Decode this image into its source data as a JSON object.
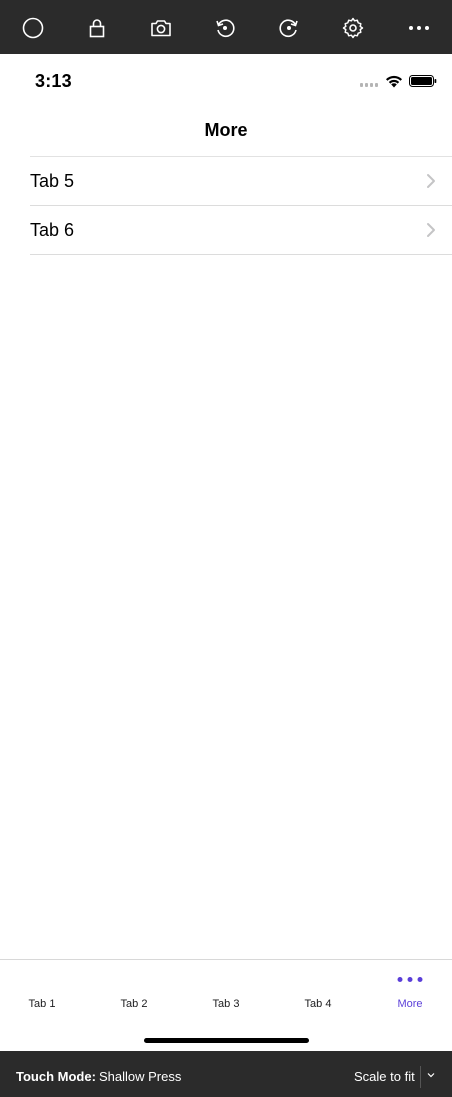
{
  "toolbar": {
    "buttons": [
      {
        "icon": "home-circle-icon"
      },
      {
        "icon": "lock-icon"
      },
      {
        "icon": "camera-icon"
      },
      {
        "icon": "rotate-left-icon"
      },
      {
        "icon": "rotate-right-icon"
      },
      {
        "icon": "gear-icon"
      },
      {
        "icon": "more-horizontal-icon"
      }
    ]
  },
  "status_bar": {
    "time": "3:13"
  },
  "nav": {
    "title": "More"
  },
  "more_list": [
    {
      "label": "Tab 5"
    },
    {
      "label": "Tab 6"
    }
  ],
  "tab_bar": {
    "tabs": [
      {
        "label": "Tab 1"
      },
      {
        "label": "Tab 2"
      },
      {
        "label": "Tab 3"
      },
      {
        "label": "Tab 4"
      },
      {
        "label": "More",
        "active": true
      }
    ],
    "accent_color": "#5b3fd9"
  },
  "bottom_bar": {
    "touch_mode_label": "Touch Mode:",
    "touch_mode_value": "Shallow Press",
    "scale_label": "Scale to fit"
  }
}
